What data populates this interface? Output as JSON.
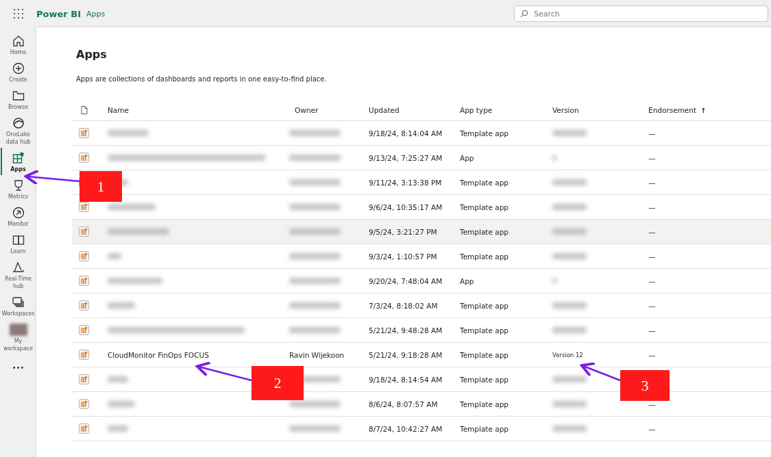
{
  "topbar": {
    "product": "Power BI",
    "section": "Apps",
    "search": {
      "placeholder": "Search"
    }
  },
  "sidebar": {
    "items": [
      {
        "label": "Home",
        "selected": false
      },
      {
        "label": "Create",
        "selected": false
      },
      {
        "label": "Browse",
        "selected": false
      },
      {
        "label": "OneLake data hub",
        "selected": false
      },
      {
        "label": "Apps",
        "selected": true
      },
      {
        "label": "Metrics",
        "selected": false
      },
      {
        "label": "Monitor",
        "selected": false
      },
      {
        "label": "Learn",
        "selected": false
      },
      {
        "label": "Real-Time hub",
        "selected": false
      },
      {
        "label": "Workspaces",
        "selected": false
      },
      {
        "label": "My workspace",
        "selected": false
      }
    ],
    "more": "•••"
  },
  "page": {
    "title": "Apps",
    "description": "Apps are collections of dashboards and reports in one easy-to-find place."
  },
  "table": {
    "columns": [
      "Name",
      "Owner",
      "Updated",
      "App type",
      "Version",
      "Endorsement"
    ],
    "sort_arrow": "↑",
    "rows": [
      {
        "updated": "9/18/24, 8:14:04 AM",
        "app_type": "Template app",
        "endorsement": "—",
        "highlighted": false
      },
      {
        "updated": "9/13/24, 7:25:27 AM",
        "app_type": "App",
        "endorsement": "—",
        "highlighted": false
      },
      {
        "updated": "9/11/24, 3:13:38 PM",
        "app_type": "Template app",
        "endorsement": "—",
        "highlighted": false
      },
      {
        "updated": "9/6/24, 10:35:17 AM",
        "app_type": "Template app",
        "endorsement": "—",
        "highlighted": false
      },
      {
        "updated": "9/5/24, 3:21:27 PM",
        "app_type": "Template app",
        "endorsement": "—",
        "highlighted": true
      },
      {
        "updated": "9/3/24, 1:10:57 PM",
        "app_type": "Template app",
        "endorsement": "—",
        "highlighted": false
      },
      {
        "updated": "9/20/24, 7:48:04 AM",
        "app_type": "App",
        "endorsement": "—",
        "highlighted": false
      },
      {
        "updated": "7/3/24, 8:18:02 AM",
        "app_type": "Template app",
        "endorsement": "—",
        "highlighted": false
      },
      {
        "updated": "5/21/24, 9:48:28 AM",
        "app_type": "Template app",
        "endorsement": "—",
        "highlighted": false
      },
      {
        "name": "CloudMonitor FinOps FOCUS",
        "owner": "Ravin Wijekoon",
        "updated": "5/21/24, 9:18:28 AM",
        "app_type": "Template app",
        "version": "Version 12",
        "endorsement": "—",
        "highlighted": false
      },
      {
        "updated": "9/18/24, 8:14:54 AM",
        "app_type": "Template app",
        "highlighted": false
      },
      {
        "updated": "8/6/24, 8:07:57 AM",
        "app_type": "Template app",
        "endorsement": "—",
        "highlighted": false
      },
      {
        "updated": "8/7/24, 10:42:27 AM",
        "app_type": "Template app",
        "endorsement": "—",
        "highlighted": false
      }
    ]
  },
  "annotations": [
    {
      "label": "1"
    },
    {
      "label": "2"
    },
    {
      "label": "3"
    }
  ]
}
